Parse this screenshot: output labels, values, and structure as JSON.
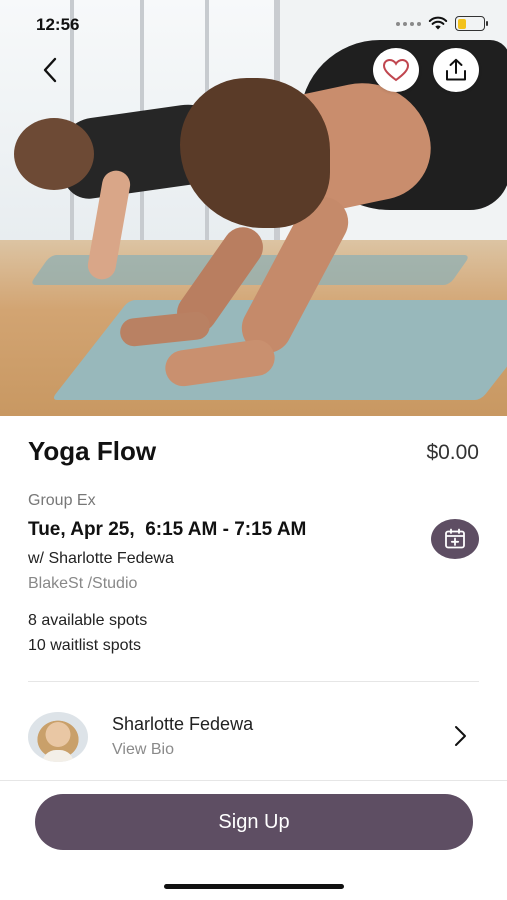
{
  "status_bar": {
    "time": "12:56",
    "battery_level": 0.34,
    "battery_color": "#f3c21c"
  },
  "nav": {
    "back_icon": "chevron-left-icon",
    "favorite_icon": "heart-icon",
    "share_icon": "share-icon"
  },
  "class": {
    "title": "Yoga Flow",
    "price": "$0.00",
    "category": "Group Ex",
    "datetime": "Tue, Apr 25,  6:15 AM - 7:15 AM",
    "instructor_line": "w/ Sharlotte Fedewa",
    "location": "BlakeSt /Studio",
    "available_spots": "8 available spots",
    "waitlist_spots": "10 waitlist spots",
    "calendar_icon": "calendar-add-icon"
  },
  "instructor": {
    "name": "Sharlotte Fedewa",
    "bio_link": "View Bio"
  },
  "actions": {
    "signup_label": "Sign Up"
  },
  "colors": {
    "accent": "#5e4e63",
    "favorite": "#c0464f"
  }
}
